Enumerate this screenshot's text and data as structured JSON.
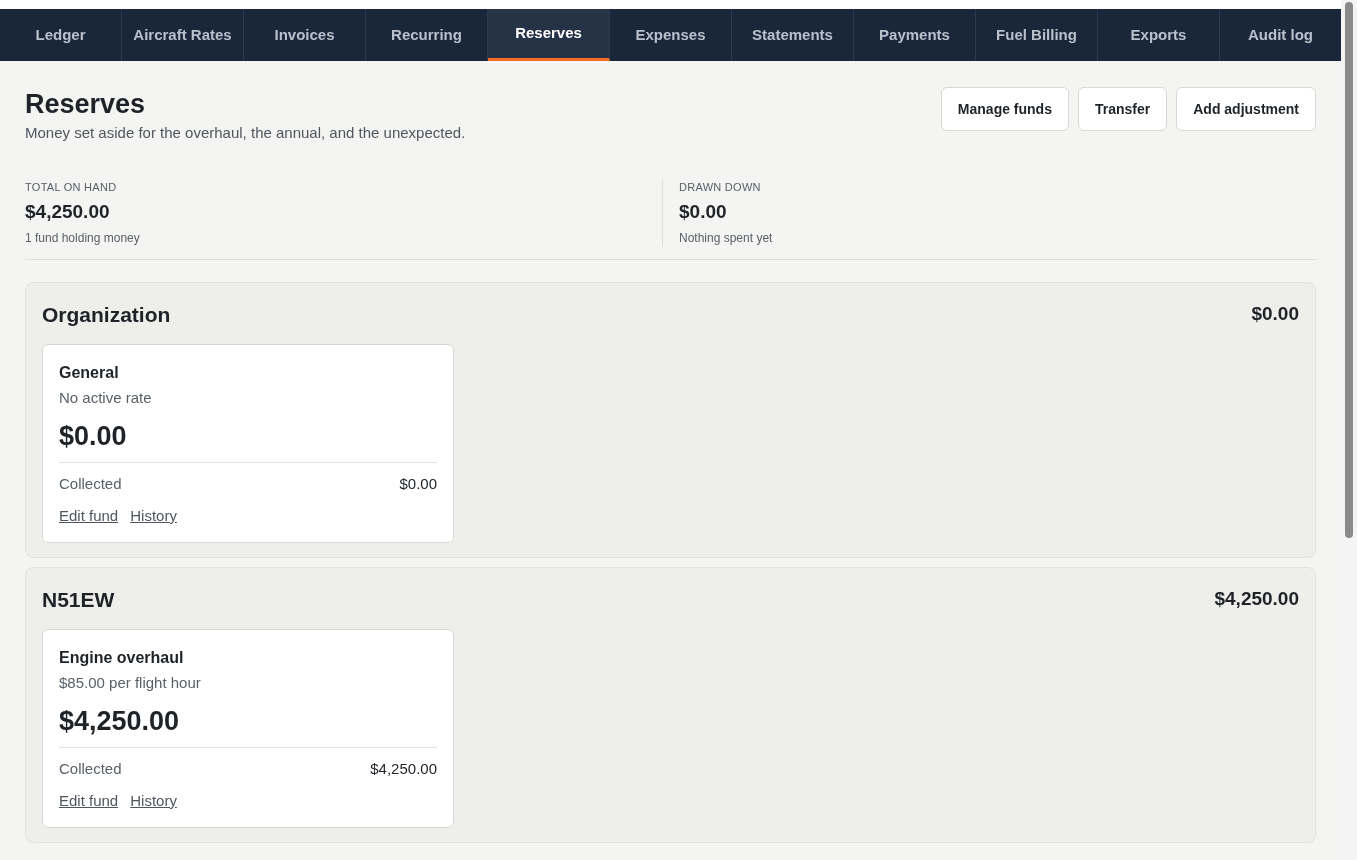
{
  "tabs": [
    {
      "label": "Ledger",
      "selected": false
    },
    {
      "label": "Aircraft Rates",
      "selected": false
    },
    {
      "label": "Invoices",
      "selected": false
    },
    {
      "label": "Recurring",
      "selected": false
    },
    {
      "label": "Reserves",
      "selected": true
    },
    {
      "label": "Expenses",
      "selected": false
    },
    {
      "label": "Statements",
      "selected": false
    },
    {
      "label": "Payments",
      "selected": false
    },
    {
      "label": "Fuel Billing",
      "selected": false
    },
    {
      "label": "Exports",
      "selected": false
    },
    {
      "label": "Audit log",
      "selected": false
    }
  ],
  "header": {
    "title": "Reserves",
    "subtitle": "Money set aside for the overhaul, the annual, and the unexpected.",
    "buttons": [
      "Manage funds",
      "Transfer",
      "Add adjustment"
    ]
  },
  "stats": [
    {
      "label": "TOTAL ON HAND",
      "value": "$4,250.00",
      "note": "1 fund holding money"
    },
    {
      "label": "DRAWN DOWN",
      "value": "$0.00",
      "note": "Nothing spent yet"
    }
  ],
  "groups": [
    {
      "name": "Organization",
      "total": "$0.00",
      "funds": [
        {
          "name": "General",
          "rate": "No active rate",
          "balance": "$0.00",
          "collected_label": "Collected",
          "collected": "$0.00",
          "links": [
            "Edit fund",
            "History"
          ]
        }
      ]
    },
    {
      "name": "N51EW",
      "total": "$4,250.00",
      "funds": [
        {
          "name": "Engine overhaul",
          "rate": "$85.00 per flight hour",
          "balance": "$4,250.00",
          "collected_label": "Collected",
          "collected": "$4,250.00",
          "links": [
            "Edit fund",
            "History"
          ]
        }
      ]
    }
  ]
}
